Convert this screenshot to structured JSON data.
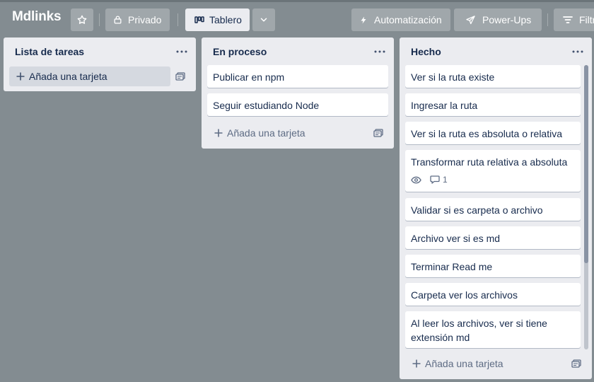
{
  "board": {
    "title": "Mdlinks",
    "privacy_label": "Privado",
    "view_label": "Tablero",
    "automation_label": "Automatización",
    "powerups_label": "Power-Ups",
    "filter_label": "Filtr"
  },
  "icons": {
    "star": "star-icon",
    "lock": "lock-icon",
    "board_view": "board-icon",
    "chevron": "chevron-down-icon",
    "bolt": "bolt-icon",
    "rocket": "rocket-icon",
    "filter": "filter-icon",
    "more": "more-icon",
    "plus": "plus-icon",
    "template": "template-icon",
    "eye": "eye-icon",
    "comment": "comment-icon"
  },
  "add_card_label": "Añada una tarjeta",
  "lists": [
    {
      "title": "Lista de tareas",
      "cards": []
    },
    {
      "title": "En proceso",
      "cards": [
        "Publicar en npm",
        "Seguir estudiando Node"
      ]
    },
    {
      "title": "Hecho",
      "cards": [
        "Ver si la ruta existe",
        "Ingresar la ruta",
        "Ver si la ruta es absoluta o relativa",
        "Transformar ruta relativa a absoluta",
        "Validar si es carpeta o archivo",
        "Archivo ver si es md",
        "Terminar Read me",
        "Carpeta ver los archivos",
        "Al leer los archivos, ver si tiene extensión md"
      ],
      "comment_count": "1"
    }
  ],
  "colors": {
    "background": "#838c91",
    "list": "#ebecf0",
    "card": "#ffffff",
    "text": "#172b4d",
    "muted": "#5e6c84"
  }
}
